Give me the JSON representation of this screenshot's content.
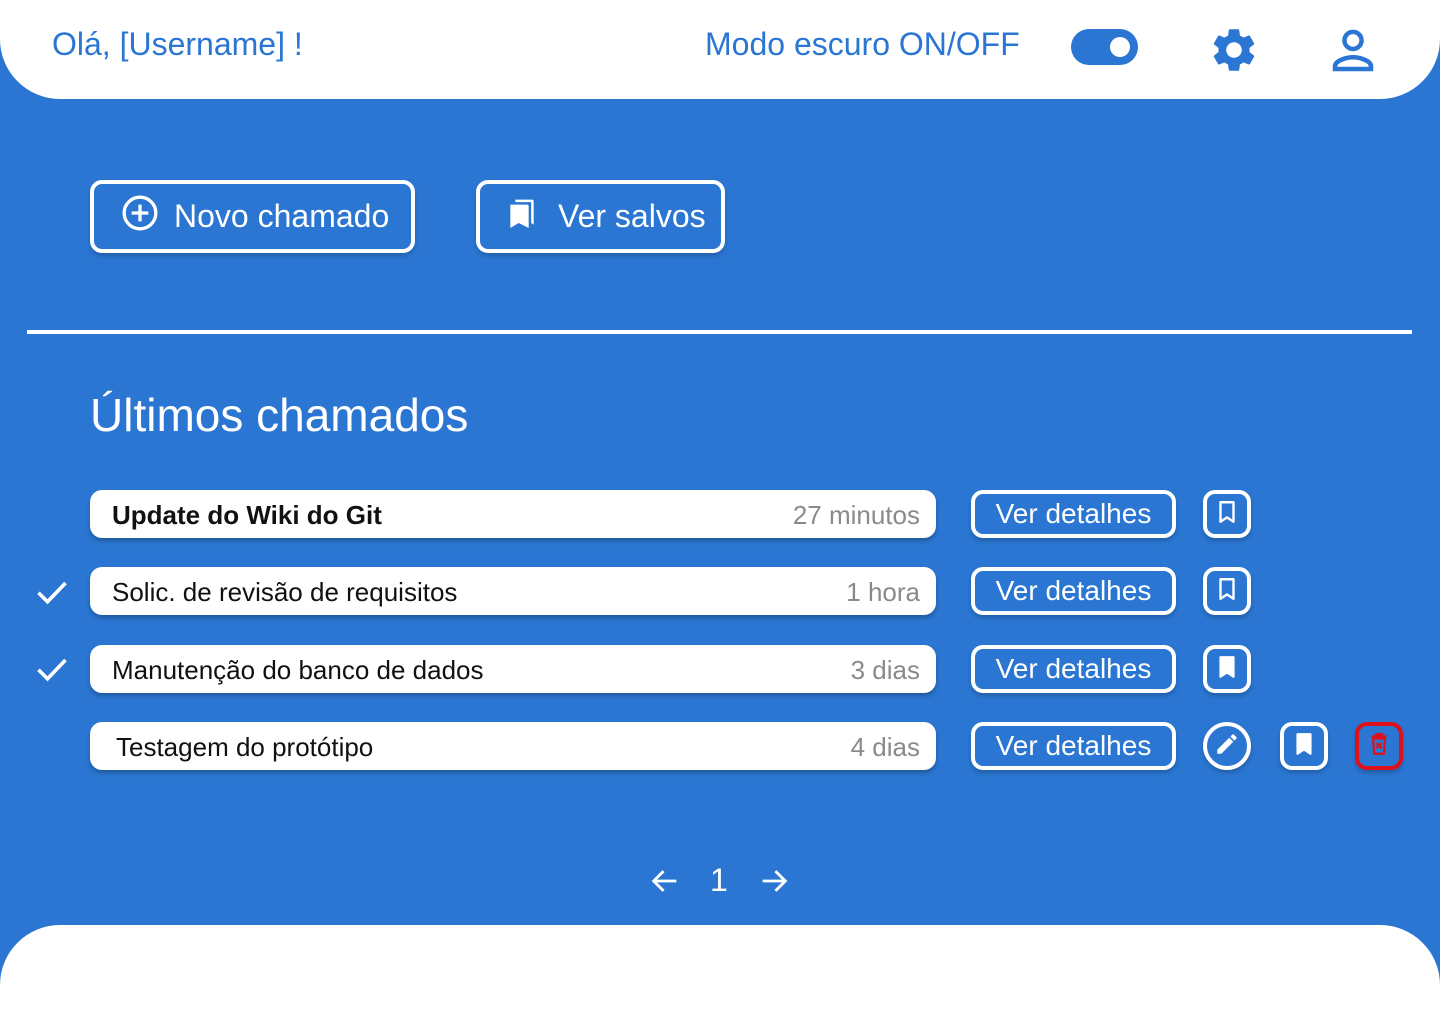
{
  "header": {
    "greeting": "Olá, [Username] !",
    "dark_mode_label": "Modo escuro ON/OFF",
    "dark_mode_on": true,
    "settings_icon": "gear-icon",
    "profile_icon": "user-icon"
  },
  "actions": {
    "new_ticket_label": "Novo chamado",
    "new_ticket_icon": "plus-circle-icon",
    "saved_label": "Ver salvos",
    "saved_icon": "bookmarks-icon"
  },
  "section": {
    "title": "Últimos chamados"
  },
  "tickets": [
    {
      "title": "Update do Wiki do Git",
      "time": "27 minutos",
      "checked": false,
      "bold": true,
      "details_label": "Ver detalhes",
      "bookmarked": false,
      "editable": false,
      "deletable": false
    },
    {
      "title": "Solic. de revisão de requisitos",
      "time": "1 hora",
      "checked": true,
      "bold": false,
      "details_label": "Ver detalhes",
      "bookmarked": false,
      "editable": false,
      "deletable": false
    },
    {
      "title": "Manutenção do banco de dados",
      "time": "3 dias",
      "checked": true,
      "bold": false,
      "details_label": "Ver detalhes",
      "bookmarked": true,
      "editable": false,
      "deletable": false
    },
    {
      "title": "Testagem do protótipo",
      "time": "4 dias",
      "checked": false,
      "bold": false,
      "details_label": "Ver detalhes",
      "bookmarked": true,
      "editable": true,
      "deletable": true
    }
  ],
  "pagination": {
    "current_page": "1"
  },
  "colors": {
    "primary": "#2a76d2",
    "danger": "#e0101a"
  }
}
